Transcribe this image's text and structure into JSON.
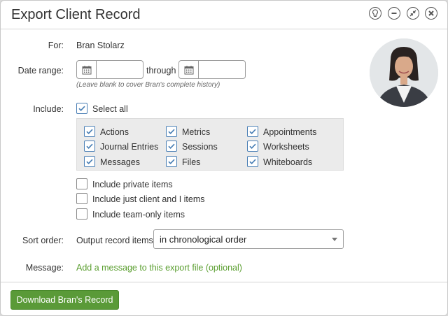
{
  "dialog": {
    "title": "Export Client Record",
    "buttons": [
      "lightbulb-icon",
      "minimize-icon",
      "collapse-icon",
      "close-icon"
    ]
  },
  "for": {
    "label": "For:",
    "value": "Bran Stolarz"
  },
  "date_range": {
    "label": "Date range:",
    "from_value": "",
    "through_label": "through",
    "to_value": "",
    "hint": "(Leave blank to cover Bran's complete history)"
  },
  "include": {
    "label": "Include:",
    "select_all": {
      "label": "Select all",
      "checked": true
    },
    "items": [
      {
        "label": "Actions",
        "checked": true
      },
      {
        "label": "Metrics",
        "checked": true
      },
      {
        "label": "Appointments",
        "checked": true
      },
      {
        "label": "Journal Entries",
        "checked": true
      },
      {
        "label": "Sessions",
        "checked": true
      },
      {
        "label": "Worksheets",
        "checked": true
      },
      {
        "label": "Messages",
        "checked": true
      },
      {
        "label": "Files",
        "checked": true
      },
      {
        "label": "Whiteboards",
        "checked": true
      }
    ],
    "extra": [
      {
        "label": "Include private items",
        "checked": false
      },
      {
        "label": "Include just client and I items",
        "checked": false
      },
      {
        "label": "Include team-only items",
        "checked": false
      }
    ]
  },
  "sort": {
    "label": "Sort order:",
    "prefix": "Output record items",
    "selected": "in chronological order"
  },
  "message": {
    "label": "Message:",
    "link": "Add a message to this export file (optional)"
  },
  "footer": {
    "download_label": "Download Bran's Record"
  },
  "colors": {
    "accent_green": "#5a9a38",
    "link_green": "#5a9e2f",
    "check_blue": "#4a7fb5"
  }
}
